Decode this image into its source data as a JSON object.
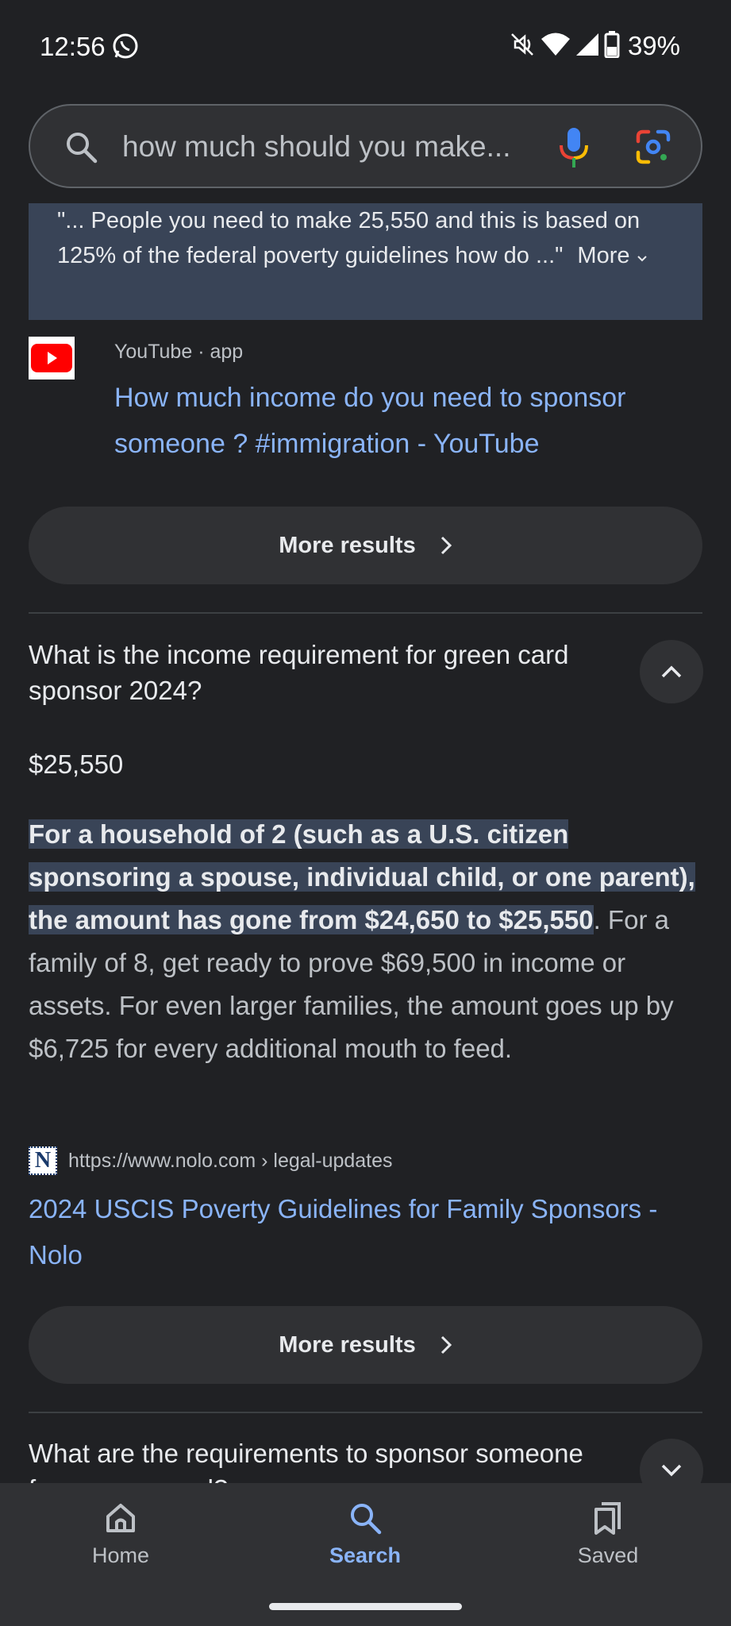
{
  "status_bar": {
    "time": "12:56",
    "battery": "39%",
    "icons": [
      "whatsapp-icon",
      "mute-icon",
      "wifi-icon",
      "signal-icon",
      "battery-icon"
    ]
  },
  "search": {
    "query": "how much should you make...",
    "icons": [
      "search-icon",
      "mic-icon",
      "lens-icon"
    ]
  },
  "snippet": {
    "text": "\"... People you need to make 25,550 and this is based on 125% of the federal poverty guidelines how do ...\"",
    "more_label": "More"
  },
  "youtube_result": {
    "source": "YouTube · app",
    "title": "How much income do you need to sponsor someone ? #immigration - YouTube"
  },
  "more_results_label": "More results",
  "question1": {
    "text": "What is the income requirement for green card sponsor 2024?",
    "answer_value": "$25,550",
    "answer_highlight": "For a household of 2 (such as a U.S. citizen sponsoring a spouse, individual child, or one parent), the amount has gone from $24,650 to $25,550",
    "answer_rest": ". For a family of 8, get ready to prove $69,500 in income or assets. For even larger families, the amount goes up by $6,725 for every additional mouth to feed.",
    "source_logo": "N",
    "source_url": "https://www.nolo.com › legal-updates",
    "source_title": "2024 USCIS Poverty Guidelines for Family Sponsors - Nolo"
  },
  "question2": {
    "text": "What are the requirements to sponsor someone for a green card?"
  },
  "bottom_nav": {
    "home": "Home",
    "search": "Search",
    "saved": "Saved"
  },
  "colors": {
    "background": "#202124",
    "link": "#8ab4f8",
    "highlight": "#394457"
  }
}
